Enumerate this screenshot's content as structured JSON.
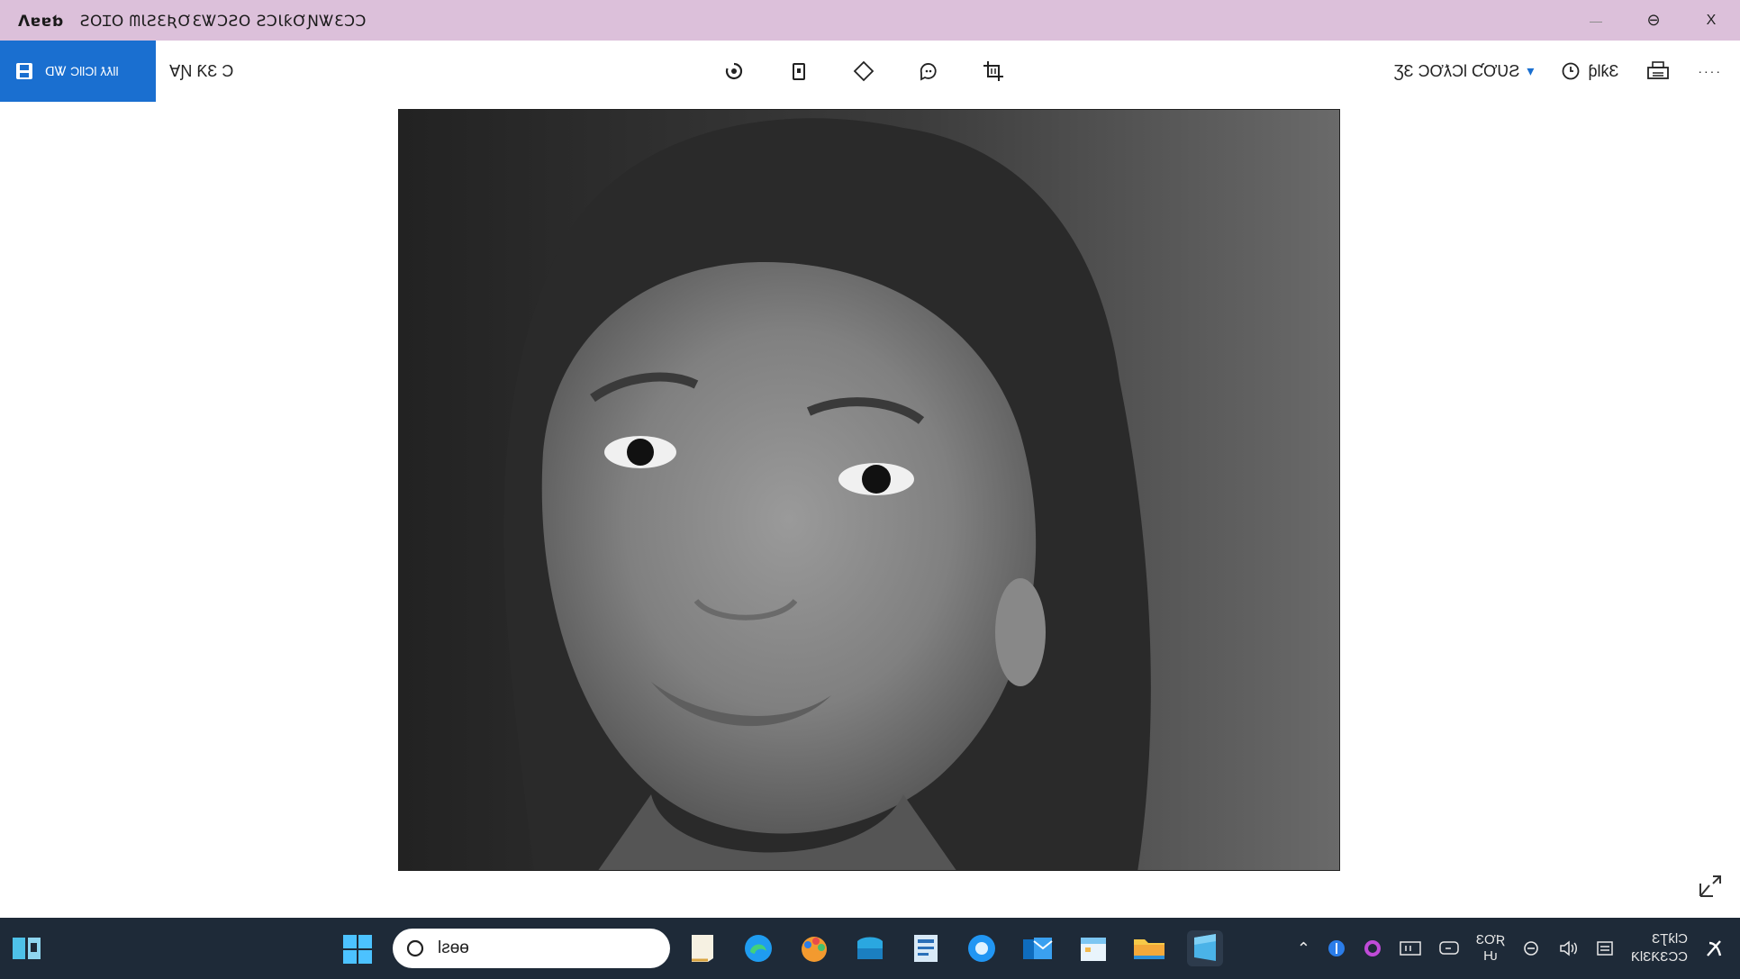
{
  "titlebar": {
    "app_name": "Ʌɐɐƅ",
    "title": "ƧOꞮO ᗰƖƧƐƦƠƐᏔƆƧO ƧƆƖƙƠƝᏔƐƆƆ",
    "minimize": "—",
    "restore": "⊖",
    "close": "X"
  },
  "toolbar": {
    "edit_label": "ᗡᏔ ƆƖƖƆƖ ƛƛƖƖ",
    "left_label": "ⱯƝ ƘƐ Ɔ",
    "right_item_1": "ƷƐ ƆƠƛƆƖ ƇƠƲƧ",
    "right_item_2": "ƥƖƙƐ",
    "more": "····"
  },
  "taskbar": {
    "search_placeholder": "Ɩƨɵɵ",
    "tray_text_1": "ƐƠƦ",
    "tray_text_2": "Ƕ",
    "clock_line_1": "ƐƮƙƖƆ",
    "clock_line_2": "ƘƖƐƘƐƆƆ"
  },
  "colors": {
    "titlebar_bg": "#dcc0da",
    "accent": "#1a6fd0",
    "taskbar_bg": "#1e2a38"
  }
}
